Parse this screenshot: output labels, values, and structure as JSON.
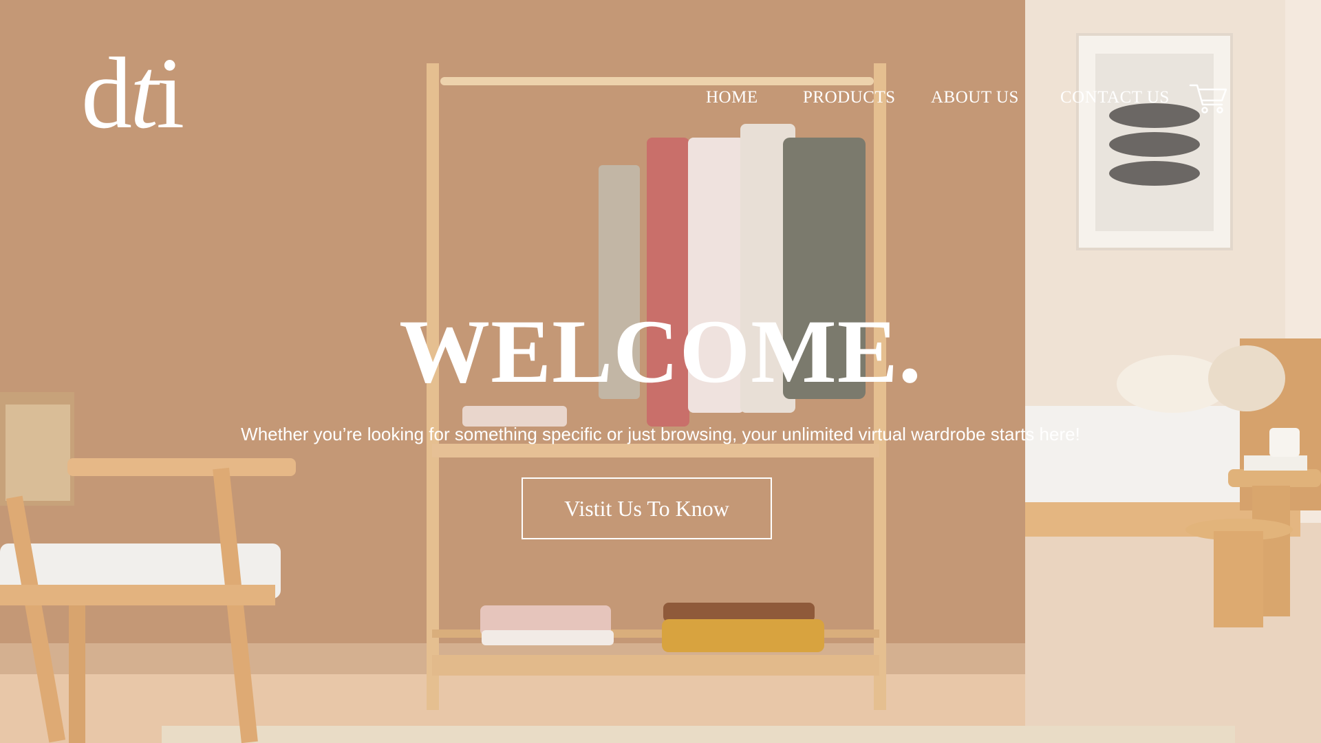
{
  "brand": {
    "logo_text_main": "d",
    "logo_text_italic": "t",
    "logo_text_end": "i"
  },
  "nav": {
    "items": [
      {
        "label": "HOME"
      },
      {
        "label": "PRODUCTS"
      },
      {
        "label": "ABOUT US"
      },
      {
        "label": "CONTACT US"
      }
    ],
    "cart_icon": "shopping-cart-icon"
  },
  "hero": {
    "title": "WELCOME.",
    "subtitle": "Whether you’re looking for something specific or just browsing, your unlimited virtual wardrobe starts here!",
    "cta_label": "Vistit Us To Know"
  },
  "colors": {
    "wall": "#c89c7a",
    "text": "#ffffff",
    "wood": "#e3bd8f",
    "bedroom_wall": "#efe0d2"
  }
}
